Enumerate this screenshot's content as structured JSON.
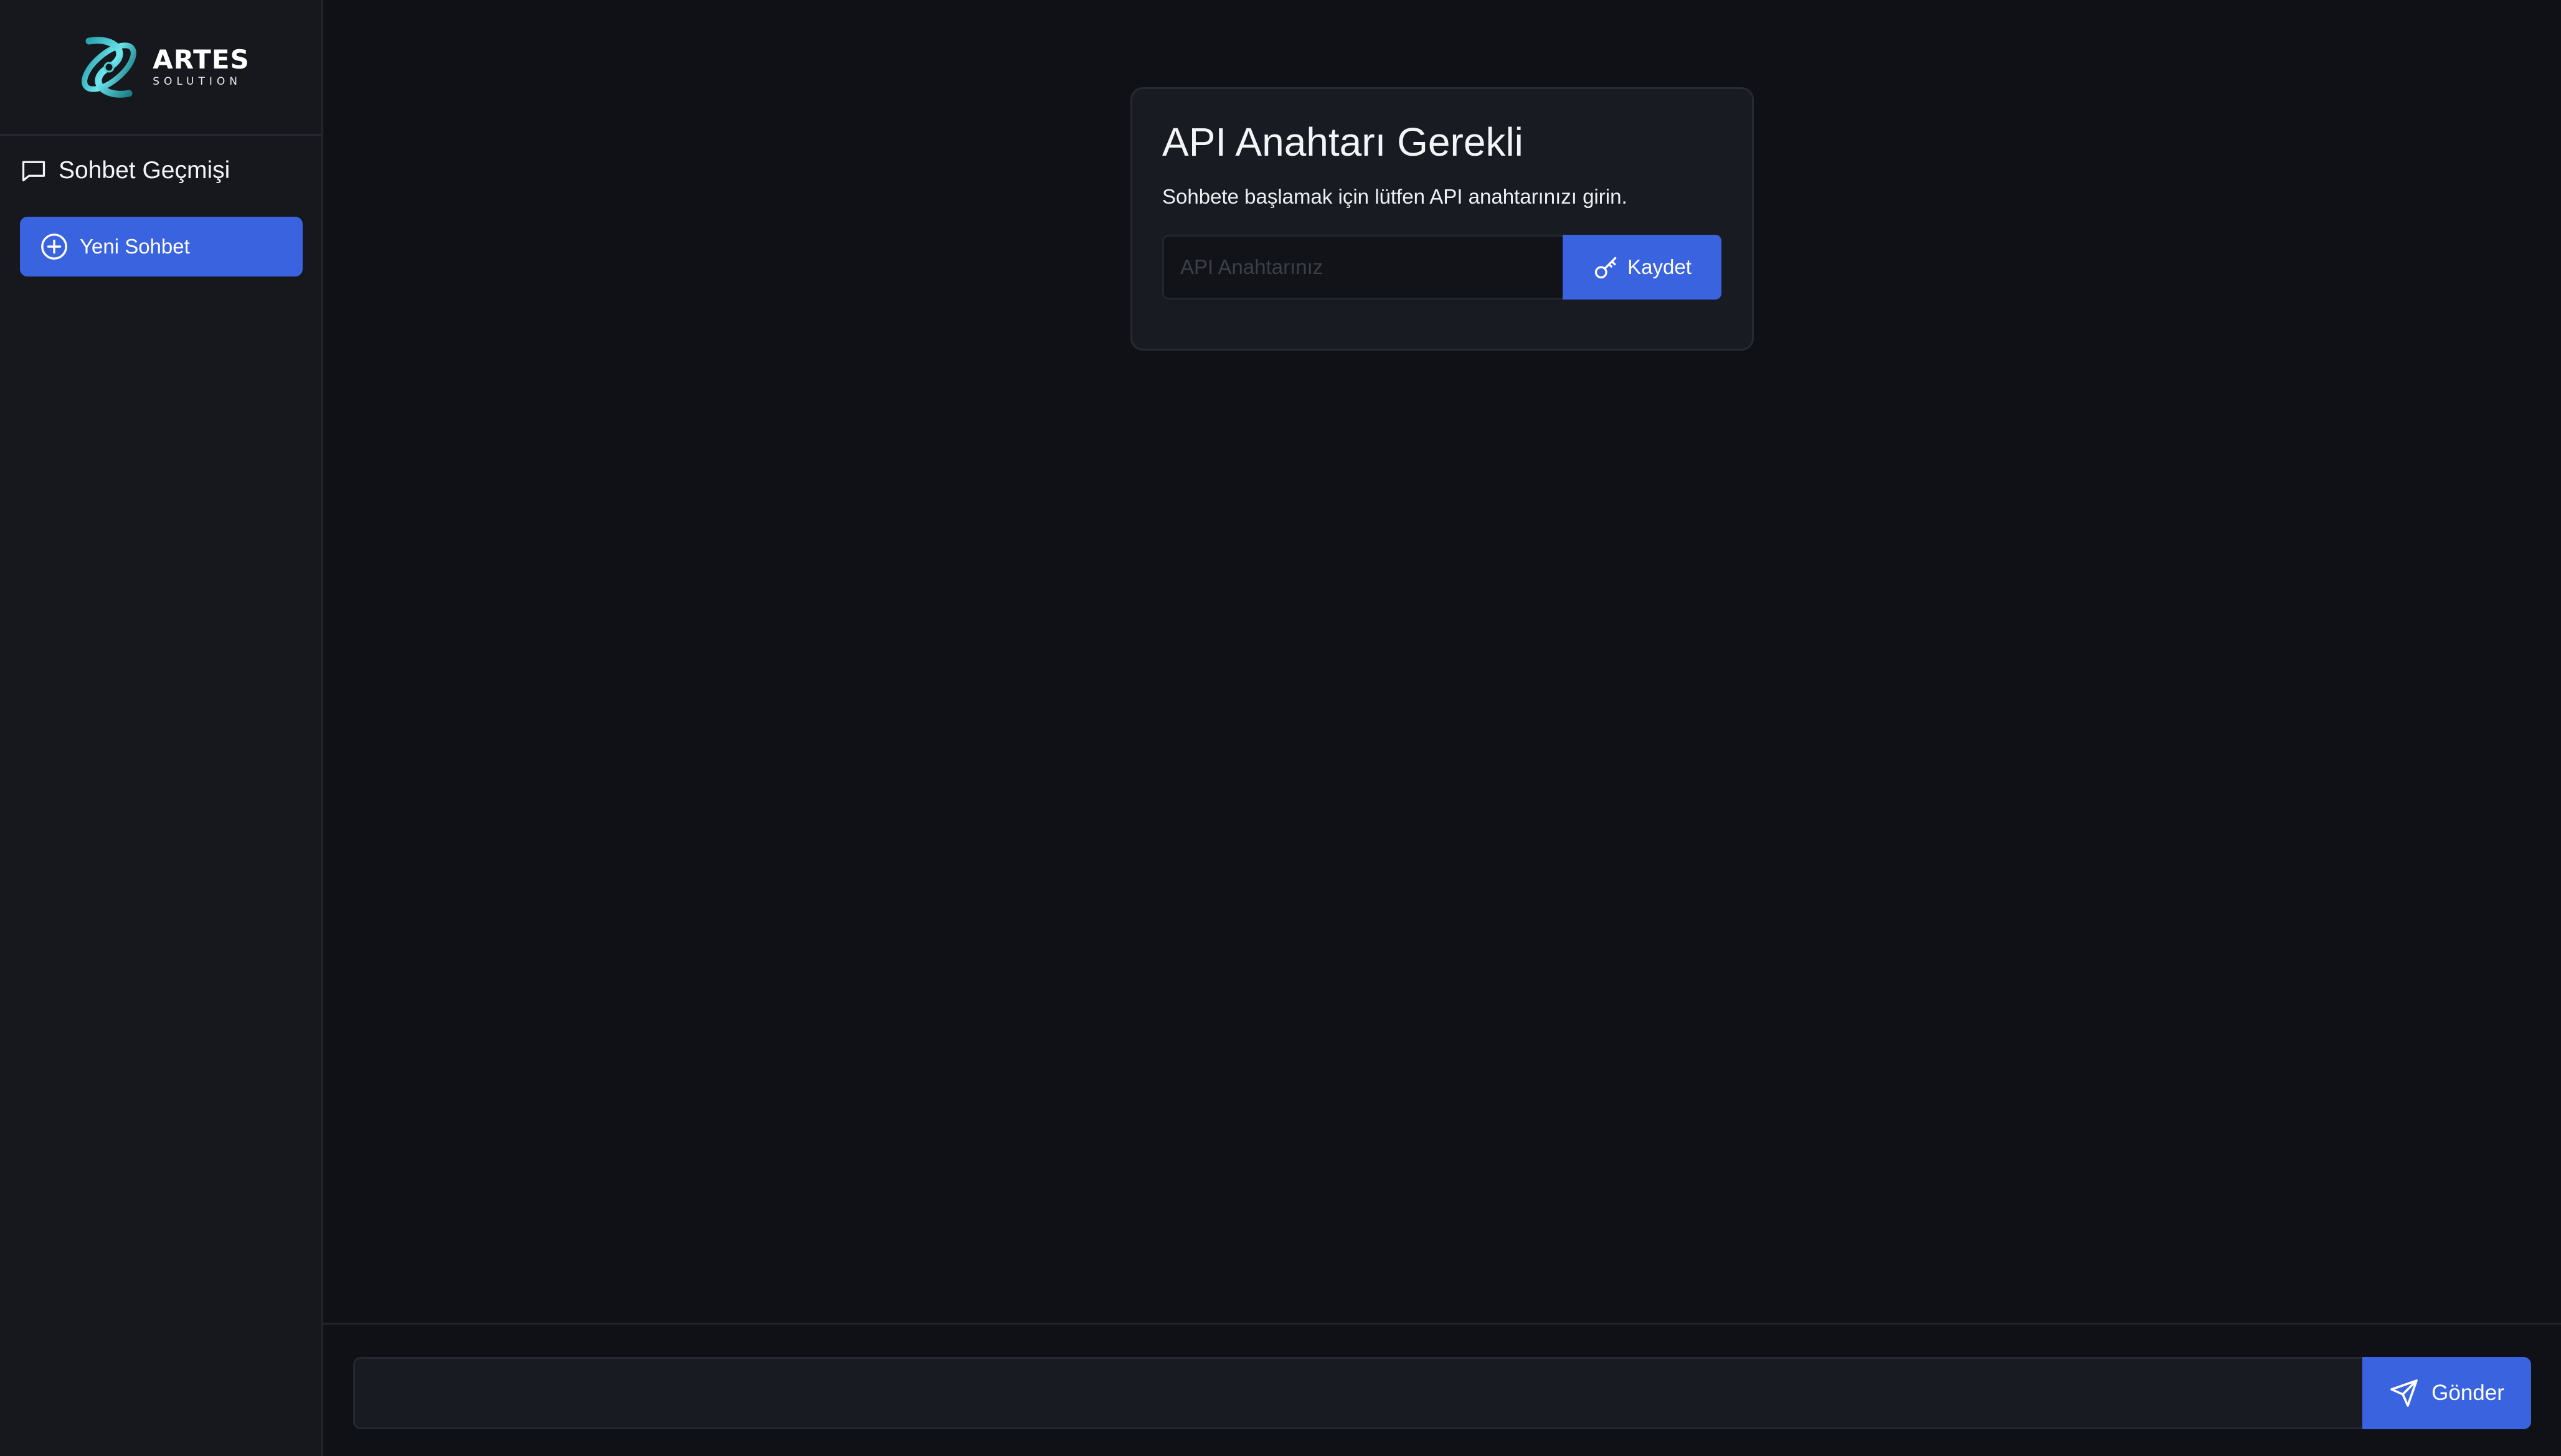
{
  "sidebar": {
    "logo": {
      "title": "ARTES",
      "subtitle": "SOLUTION"
    },
    "history_title": "Sohbet Geçmişi",
    "history_icon": "chat-bubble-icon",
    "new_chat_label": "Yeni Sohbet",
    "new_chat_icon": "plus-circle-icon"
  },
  "api_card": {
    "title": "API Anahtarı Gerekli",
    "description": "Sohbete başlamak için lütfen API anahtarınızı girin.",
    "input_placeholder": "API Anahtarınız",
    "input_value": "",
    "save_label": "Kaydet",
    "save_icon": "key-icon"
  },
  "composer": {
    "input_value": "",
    "send_label": "Gönder",
    "send_icon": "send-icon"
  },
  "colors": {
    "accent": "#3a63e0",
    "background": "#101116",
    "sidebar": "#16181e",
    "card": "#191b22",
    "logo_teal": "#4fd1d9"
  }
}
